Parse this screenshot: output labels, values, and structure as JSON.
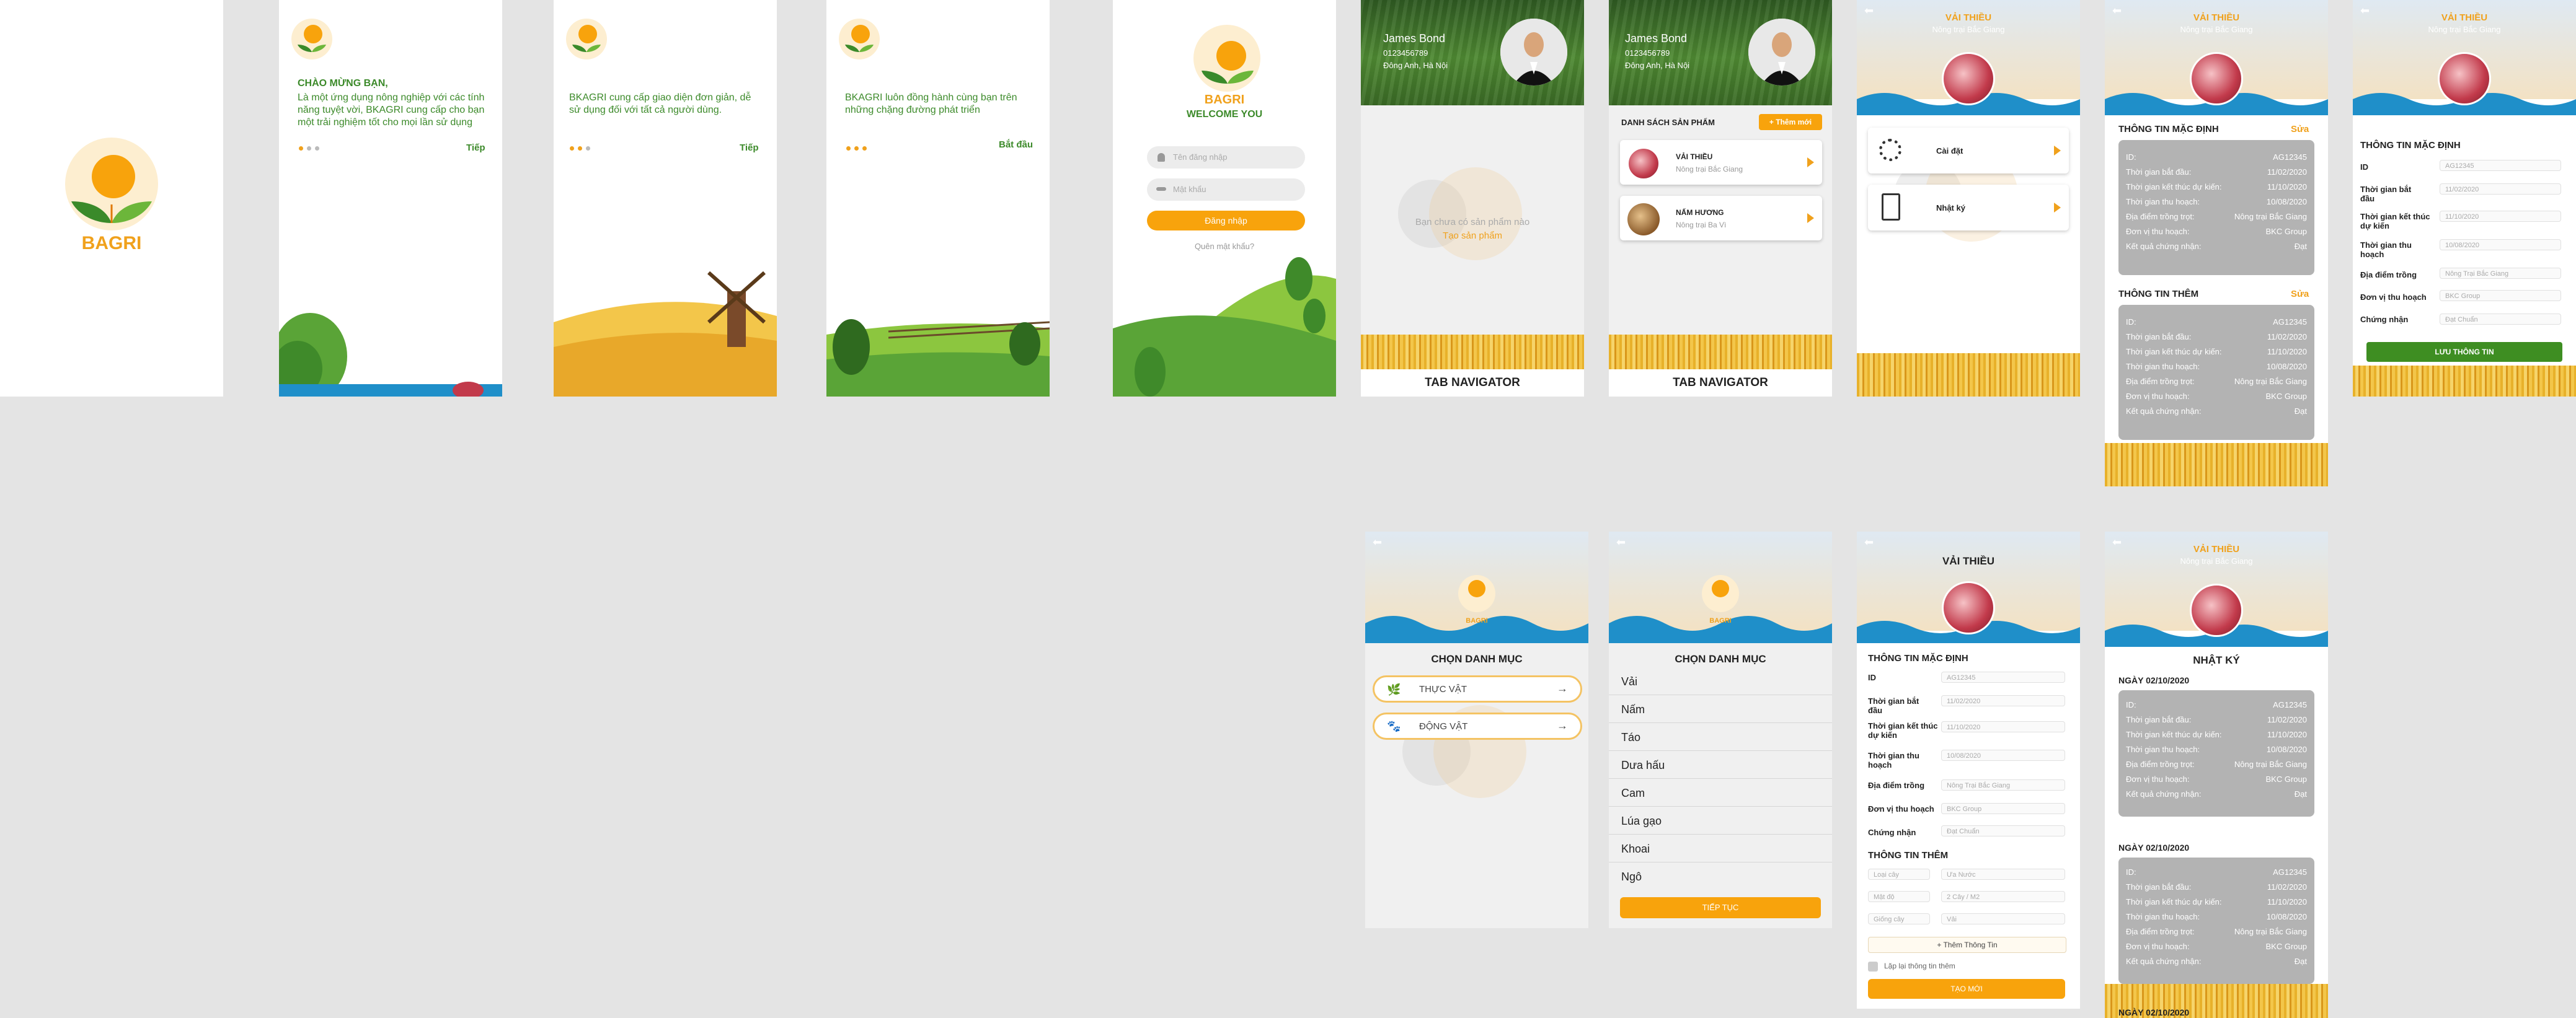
{
  "brand": {
    "name": "BAGRI",
    "welcome": "WELCOME YOU"
  },
  "splash": {
    "title": "BAGRI"
  },
  "intro1": {
    "heading": "CHÀO MỪNG BẠN,",
    "body": "Là một ứng dụng nông nghiệp với các tính năng tuyệt vời, BKAGRI cung cấp cho bạn một trải nghiệm tốt cho mọi lần sử dụng",
    "next": "Tiếp"
  },
  "intro2": {
    "body": "BKAGRI cung cấp giao diện đơn giản, dễ sử dụng đối với tất cả người dùng.",
    "next": "Tiếp"
  },
  "intro3": {
    "body": "BKAGRI luôn đồng hành cùng bạn trên những chặng đường phát triển",
    "next": "Bắt đầu"
  },
  "login": {
    "username_placeholder": "Tên đăng nhập",
    "password_placeholder": "Mật khẩu",
    "submit": "Đăng nhập",
    "forgot": "Quên mật khẩu?"
  },
  "profile": {
    "name": "James Bond",
    "phone": "0123456789",
    "address": "Đông Anh, Hà Nội"
  },
  "empty": {
    "message": "Bạn chưa có sản phẩm nào",
    "create": "Tạo sản phẩm"
  },
  "tabnav": "TAB NAVIGATOR",
  "products": {
    "heading": "DANH SÁCH SẢN PHẨM",
    "add": "+ Thêm mới",
    "items": [
      {
        "name": "VẢI THIỀU",
        "farm": "Nông trại Bắc Giang"
      },
      {
        "name": "NẤM HƯƠNG",
        "farm": "Nông trại Ba Vì"
      }
    ]
  },
  "product_header": {
    "name": "VẢI THIỀU",
    "farm": "Nông trại Bắc Giang"
  },
  "menu": {
    "settings": "Cài đặt",
    "diary": "Nhật ký"
  },
  "default_info": {
    "title": "THÔNG TIN MẶC ĐỊNH",
    "edit": "Sửa",
    "rows": [
      {
        "label": "ID:",
        "value": "AG12345"
      },
      {
        "label": "Thời gian bắt đầu:",
        "value": "11/02/2020"
      },
      {
        "label": "Thời gian kết thúc dự kiến:",
        "value": "11/10/2020"
      },
      {
        "label": "Thời gian thu hoạch:",
        "value": "10/08/2020"
      },
      {
        "label": "Địa điểm trồng trọt:",
        "value": "Nông trại Bắc Giang"
      },
      {
        "label": "Đơn vị thu hoạch:",
        "value": "BKC Group"
      },
      {
        "label": "Kết quả chứng nhận:",
        "value": "Đạt"
      }
    ]
  },
  "extra_info": {
    "title": "THÔNG TIN THÊM",
    "edit": "Sửa"
  },
  "edit_form": {
    "title": "THÔNG TIN MẶC ĐỊNH",
    "fields": [
      {
        "label": "ID",
        "value": "AG12345"
      },
      {
        "label": "Thời gian bắt đầu",
        "value": "11/02/2020"
      },
      {
        "label": "Thời gian kết thúc dự kiến",
        "value": "11/10/2020"
      },
      {
        "label": "Thời gian thu hoạch",
        "value": "10/08/2020"
      },
      {
        "label": "Địa điểm trồng",
        "value": "Nông Trại Bắc Giang"
      },
      {
        "label": "Đơn vị thu hoạch",
        "value": "BKC Group"
      },
      {
        "label": "Chứng nhận",
        "value": "Đạt Chuẩn"
      }
    ],
    "save": "LƯU THÔNG TIN"
  },
  "category": {
    "title": "CHỌN DANH MỤC",
    "plant": "THỰC VẬT",
    "animal": "ĐỘNG VẬT"
  },
  "category_list": {
    "title": "CHỌN DANH MỤC",
    "items": [
      "Vải",
      "Nấm",
      "Táo",
      "Dưa hấu",
      "Cam",
      "Lúa gạo",
      "Khoai",
      "Ngô"
    ],
    "continue": "TIẾP TỤC"
  },
  "create_form": {
    "product": "VẢI THIỀU",
    "section1": "THÔNG TIN MẶC ĐỊNH",
    "fields": [
      {
        "label": "ID",
        "value": "AG12345"
      },
      {
        "label": "Thời gian bắt đầu",
        "value": "11/02/2020"
      },
      {
        "label": "Thời gian kết thúc dự kiến",
        "value": "11/10/2020"
      },
      {
        "label": "Thời gian thu hoạch",
        "value": "10/08/2020"
      },
      {
        "label": "Địa điểm trồng",
        "value": "Nông Trại Bắc Giang"
      },
      {
        "label": "Đơn vị thu hoạch",
        "value": "BKC Group"
      },
      {
        "label": "Chứng nhận",
        "value": "Đạt Chuẩn"
      }
    ],
    "section2": "THÔNG TIN THÊM",
    "extra": [
      {
        "key": "Loại cây",
        "value": "Ưa Nước"
      },
      {
        "key": "Mật độ",
        "value": "2 Cây / M2"
      },
      {
        "key": "Giống cây",
        "value": "Vải"
      }
    ],
    "add_info": "+ Thêm Thông Tin",
    "repeat": "Lặp lại thông tin thêm",
    "create": "TẠO MỚI"
  },
  "diary": {
    "title": "NHẬT KÝ",
    "date1": "NGÀY 02/10/2020",
    "date2": "NGÀY 02/10/2020",
    "date3": "NGÀY 02/10/2020"
  },
  "colors": {
    "orange": "#f8a30c",
    "green": "#3c8a2a",
    "grey": "#b3b3b3",
    "wave": "#1f8fc9"
  }
}
